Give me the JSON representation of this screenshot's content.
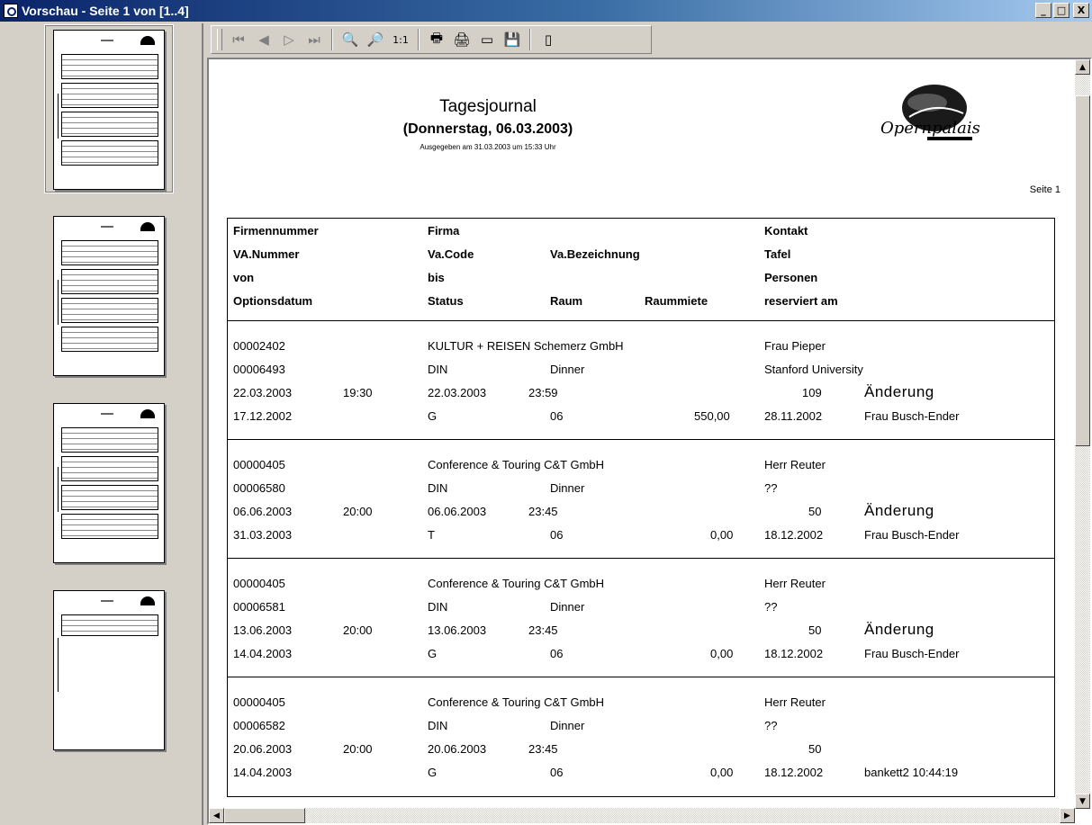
{
  "window": {
    "title": "Vorschau - Seite 1 von [1..4]",
    "buttons": {
      "minimize": "_",
      "maximize": "□",
      "close": "X"
    }
  },
  "thumbnails": [
    {
      "page": 1,
      "selected": true
    },
    {
      "page": 2,
      "selected": false
    },
    {
      "page": 3,
      "selected": false
    },
    {
      "page": 4,
      "selected": false
    }
  ],
  "toolbar": {
    "zoom_actual": "1:1"
  },
  "report": {
    "title": "Tagesjournal",
    "subtitle": "(Donnerstag, 06.03.2003)",
    "issued": "Ausgegeben am 31.03.2003 um 15:33 Uhr",
    "logo_text": "Opernpalais",
    "page_label": "Seite 1",
    "headers": {
      "col1": [
        "Firmennummer",
        "VA.Nummer",
        "von",
        "Optionsdatum"
      ],
      "col2": [
        "Firma",
        "Va.Code",
        "bis",
        "Status"
      ],
      "col3": [
        "",
        "Va.Bezeichnung",
        "",
        "Raum"
      ],
      "col4": [
        "",
        "",
        "",
        "Raummiete"
      ],
      "col5": [
        "Kontakt",
        "Tafel",
        "Personen",
        "reserviert am"
      ]
    },
    "records": [
      {
        "firmennr": "00002402",
        "firma": "KULTUR + REISEN Schemerz GmbH",
        "kontakt": "Frau Pieper",
        "vanr": "00006493",
        "vacode": "DIN",
        "vabez": "Dinner",
        "tafel": "Stanford University",
        "von_datum": "22.03.2003",
        "von_zeit": "19:30",
        "bis_datum": "22.03.2003",
        "bis_zeit": "23:59",
        "personen": "109",
        "aenderung": "Änderung",
        "optionsdatum": "17.12.2002",
        "status": "G",
        "raum": "06",
        "raummiete": "550,00",
        "reserviert_datum": "28.11.2002",
        "reserviert_von": "Frau Busch-Ender"
      },
      {
        "firmennr": "00000405",
        "firma": "Conference & Touring C&T GmbH",
        "kontakt": "Herr Reuter",
        "vanr": "00006580",
        "vacode": "DIN",
        "vabez": "Dinner",
        "tafel": "??",
        "von_datum": "06.06.2003",
        "von_zeit": "20:00",
        "bis_datum": "06.06.2003",
        "bis_zeit": "23:45",
        "personen": "50",
        "aenderung": "Änderung",
        "optionsdatum": "31.03.2003",
        "status": "T",
        "raum": "06",
        "raummiete": "0,00",
        "reserviert_datum": "18.12.2002",
        "reserviert_von": "Frau Busch-Ender"
      },
      {
        "firmennr": "00000405",
        "firma": "Conference & Touring C&T GmbH",
        "kontakt": "Herr Reuter",
        "vanr": "00006581",
        "vacode": "DIN",
        "vabez": "Dinner",
        "tafel": "??",
        "von_datum": "13.06.2003",
        "von_zeit": "20:00",
        "bis_datum": "13.06.2003",
        "bis_zeit": "23:45",
        "personen": "50",
        "aenderung": "Änderung",
        "optionsdatum": "14.04.2003",
        "status": "G",
        "raum": "06",
        "raummiete": "0,00",
        "reserviert_datum": "18.12.2002",
        "reserviert_von": "Frau Busch-Ender"
      },
      {
        "firmennr": "00000405",
        "firma": "Conference & Touring C&T GmbH",
        "kontakt": "Herr Reuter",
        "vanr": "00006582",
        "vacode": "DIN",
        "vabez": "Dinner",
        "tafel": "??",
        "von_datum": "20.06.2003",
        "von_zeit": "20:00",
        "bis_datum": "20.06.2003",
        "bis_zeit": "23:45",
        "personen": "50",
        "aenderung": "",
        "optionsdatum": "14.04.2003",
        "status": "G",
        "raum": "06",
        "raummiete": "0,00",
        "reserviert_datum": "18.12.2002",
        "reserviert_von": "bankett2 10:44:19"
      }
    ]
  }
}
